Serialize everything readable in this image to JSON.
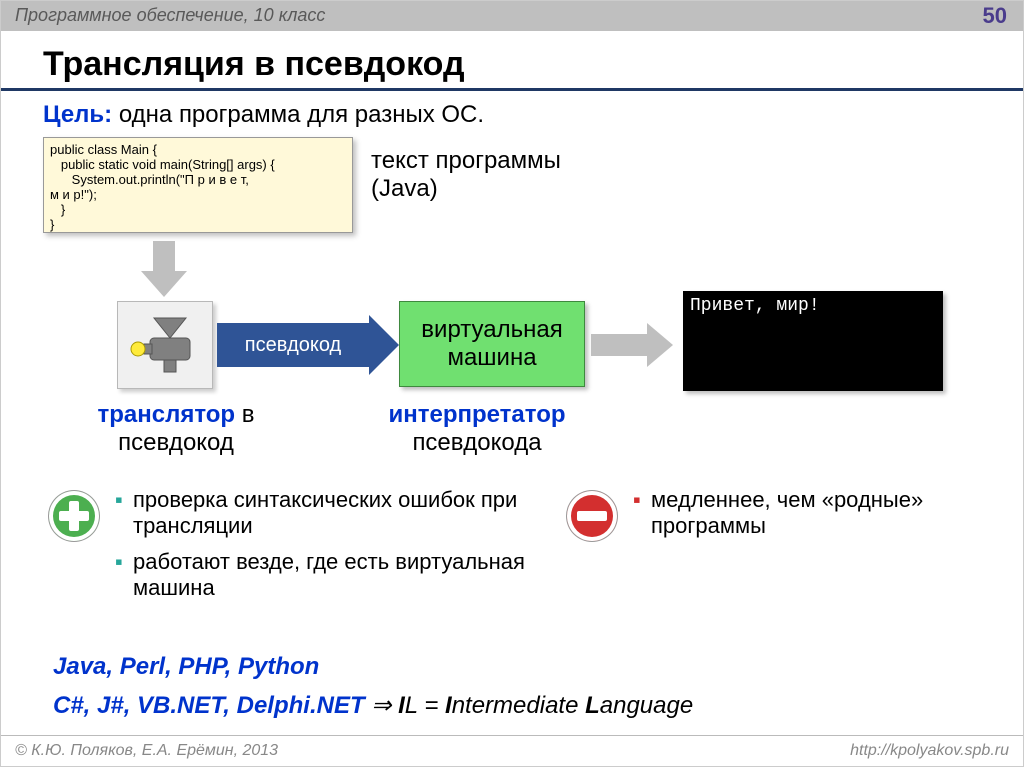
{
  "header": {
    "breadcrumb": "Программное обеспечение, 10 класс",
    "page_number": "50"
  },
  "title": "Трансляция в псевдокод",
  "goal": {
    "label": "Цель",
    "text": "одна программа для разных ОС."
  },
  "code": "public class Main {\n   public static void main(String[] args) {\n      System.out.println(\"П р и в е т,\nм и р!\");\n   }\n}",
  "source_label": "текст программы\n(Java)",
  "pseudocode_arrow": "псевдокод",
  "vm": {
    "line1": "виртуальная",
    "line2": "машина"
  },
  "console_output": "Привет, мир!",
  "translator_label": {
    "bold": "транслятор",
    "rest": " в",
    "line2": "псевдокод"
  },
  "interpreter_label": {
    "bold": "интерпретатор",
    "line2": "псевдокода"
  },
  "pros": [
    "проверка синтаксических ошибок при трансляции",
    "работают везде, где есть виртуальная машина"
  ],
  "cons": [
    "медленнее, чем «родные» программы"
  ],
  "langs_line1": "Java, Perl, PHP, Python",
  "langs_line2": {
    "langs": "C#, J#, VB.NET, Delphi.NET",
    "arrow": " ⇒ ",
    "il_b1": "I",
    "il_1": "L = ",
    "il_b2": "I",
    "il_2": "ntermediate ",
    "il_b3": "L",
    "il_3": "anguage"
  },
  "footer": {
    "copyright": "© К.Ю. Поляков, Е.А. Ерёмин, 2013",
    "url": "http://kpolyakov.spb.ru"
  }
}
